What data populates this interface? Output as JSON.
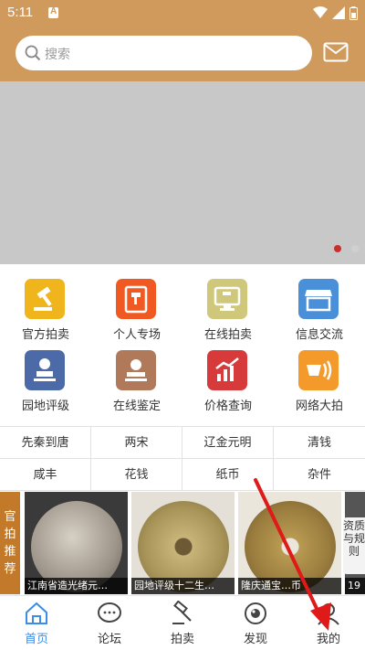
{
  "status_bar": {
    "time": "5:11"
  },
  "search": {
    "placeholder": "搜索"
  },
  "categories": [
    {
      "label": "官方拍卖",
      "icon": "gavel-icon",
      "color": "#f0b51d"
    },
    {
      "label": "个人专场",
      "icon": "gavel-doc-icon",
      "color": "#f05a22"
    },
    {
      "label": "在线拍卖",
      "icon": "monitor-gavel-icon",
      "color": "#cfc77a"
    },
    {
      "label": "信息交流",
      "icon": "store-icon",
      "color": "#4a90d9"
    },
    {
      "label": "园地评级",
      "icon": "stamp-icon",
      "color": "#4c6aa8"
    },
    {
      "label": "在线鉴定",
      "icon": "seal-stamp-icon",
      "color": "#b07a5a"
    },
    {
      "label": "价格查询",
      "icon": "chart-icon",
      "color": "#d63a3a"
    },
    {
      "label": "网络大拍",
      "icon": "broadcast-icon",
      "color": "#f39a2a"
    }
  ],
  "tags": [
    "先秦到唐",
    "两宋",
    "辽金元明",
    "清钱",
    "咸丰",
    "花钱",
    "纸币",
    "杂件"
  ],
  "recommend": {
    "side_label": "官拍推荐",
    "items": [
      {
        "caption": "江南省造光绪元…"
      },
      {
        "caption": "园地评级十二生…"
      },
      {
        "caption": "隆庆通宝…币"
      },
      {
        "caption": "19"
      }
    ],
    "right_tab": "资质与规则"
  },
  "bottom_nav": [
    {
      "label": "首页",
      "icon": "home-icon"
    },
    {
      "label": "论坛",
      "icon": "chat-icon"
    },
    {
      "label": "拍卖",
      "icon": "gavel-icon"
    },
    {
      "label": "发现",
      "icon": "discover-icon"
    },
    {
      "label": "我的",
      "icon": "user-icon"
    }
  ],
  "colors": {
    "header": "#d09a5c",
    "active_nav": "#3a8ee6",
    "banner_dot_active": "#c9302c"
  }
}
